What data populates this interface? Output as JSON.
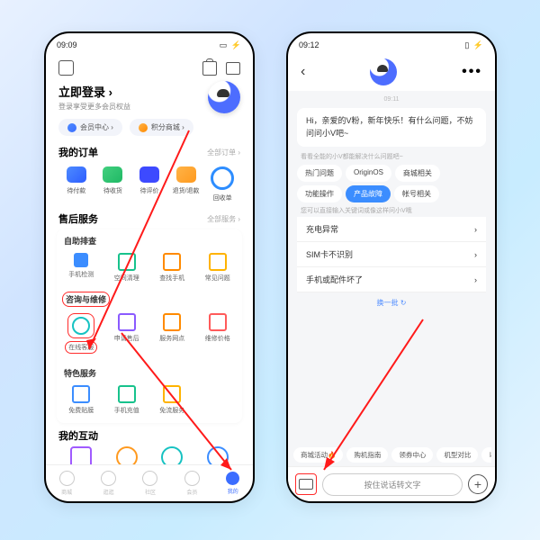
{
  "left": {
    "time": "09:09",
    "status_icons": "◎ ⬨ ⦿",
    "battery": "▭ ⚡",
    "login_title": "立即登录 ›",
    "login_sub": "登录享受更多会员权益",
    "pill_member": "会员中心 ›",
    "pill_points": "积分商城 ›",
    "orders_title": "我的订单",
    "orders_more": "全部订单 ›",
    "orders": [
      "待付款",
      "待收货",
      "待评价",
      "退货/退款",
      "回收单"
    ],
    "after_title": "售后服务",
    "after_more": "全部服务 ›",
    "self_title": "自助排查",
    "self_items": [
      "手机检测",
      "空间清理",
      "查找手机",
      "常见问题"
    ],
    "consult_title": "咨询与维修",
    "consult_items": [
      "在线客服",
      "申请售后",
      "服务网点",
      "维修价格"
    ],
    "special_title": "特色服务",
    "special_items": [
      "免费贴膜",
      "手机充值",
      "免流服务"
    ],
    "interact_title": "我的互动",
    "tabs": [
      "商城",
      "逛逛",
      "社区",
      "会员",
      "我的"
    ]
  },
  "right": {
    "time": "09:12",
    "status_icons": "◎ ⬨ ⦿",
    "battery": "▯ ⚡",
    "chat_ts": "09:11",
    "greet": "Hi，亲爱的V粉，新年快乐！有什么问题，不妨问问小V吧~",
    "hint1": "看看全能的小V都能解决什么问题吧~",
    "chips": [
      "热门问题",
      "OriginOS",
      "商城相关",
      "功能操作",
      "产品故障",
      "帐号相关"
    ],
    "chip_active": 4,
    "hint2": "您可以直接输入关键词或像这样问小V哦",
    "faqs": [
      "充电异常",
      "SIM卡不识别",
      "手机或配件坏了"
    ],
    "refresh": "换一批 ↻",
    "quick": [
      "商城活动🔥",
      "购机指南",
      "领券中心",
      "机型对比",
      "以"
    ],
    "voice": "按住说话转文字"
  }
}
